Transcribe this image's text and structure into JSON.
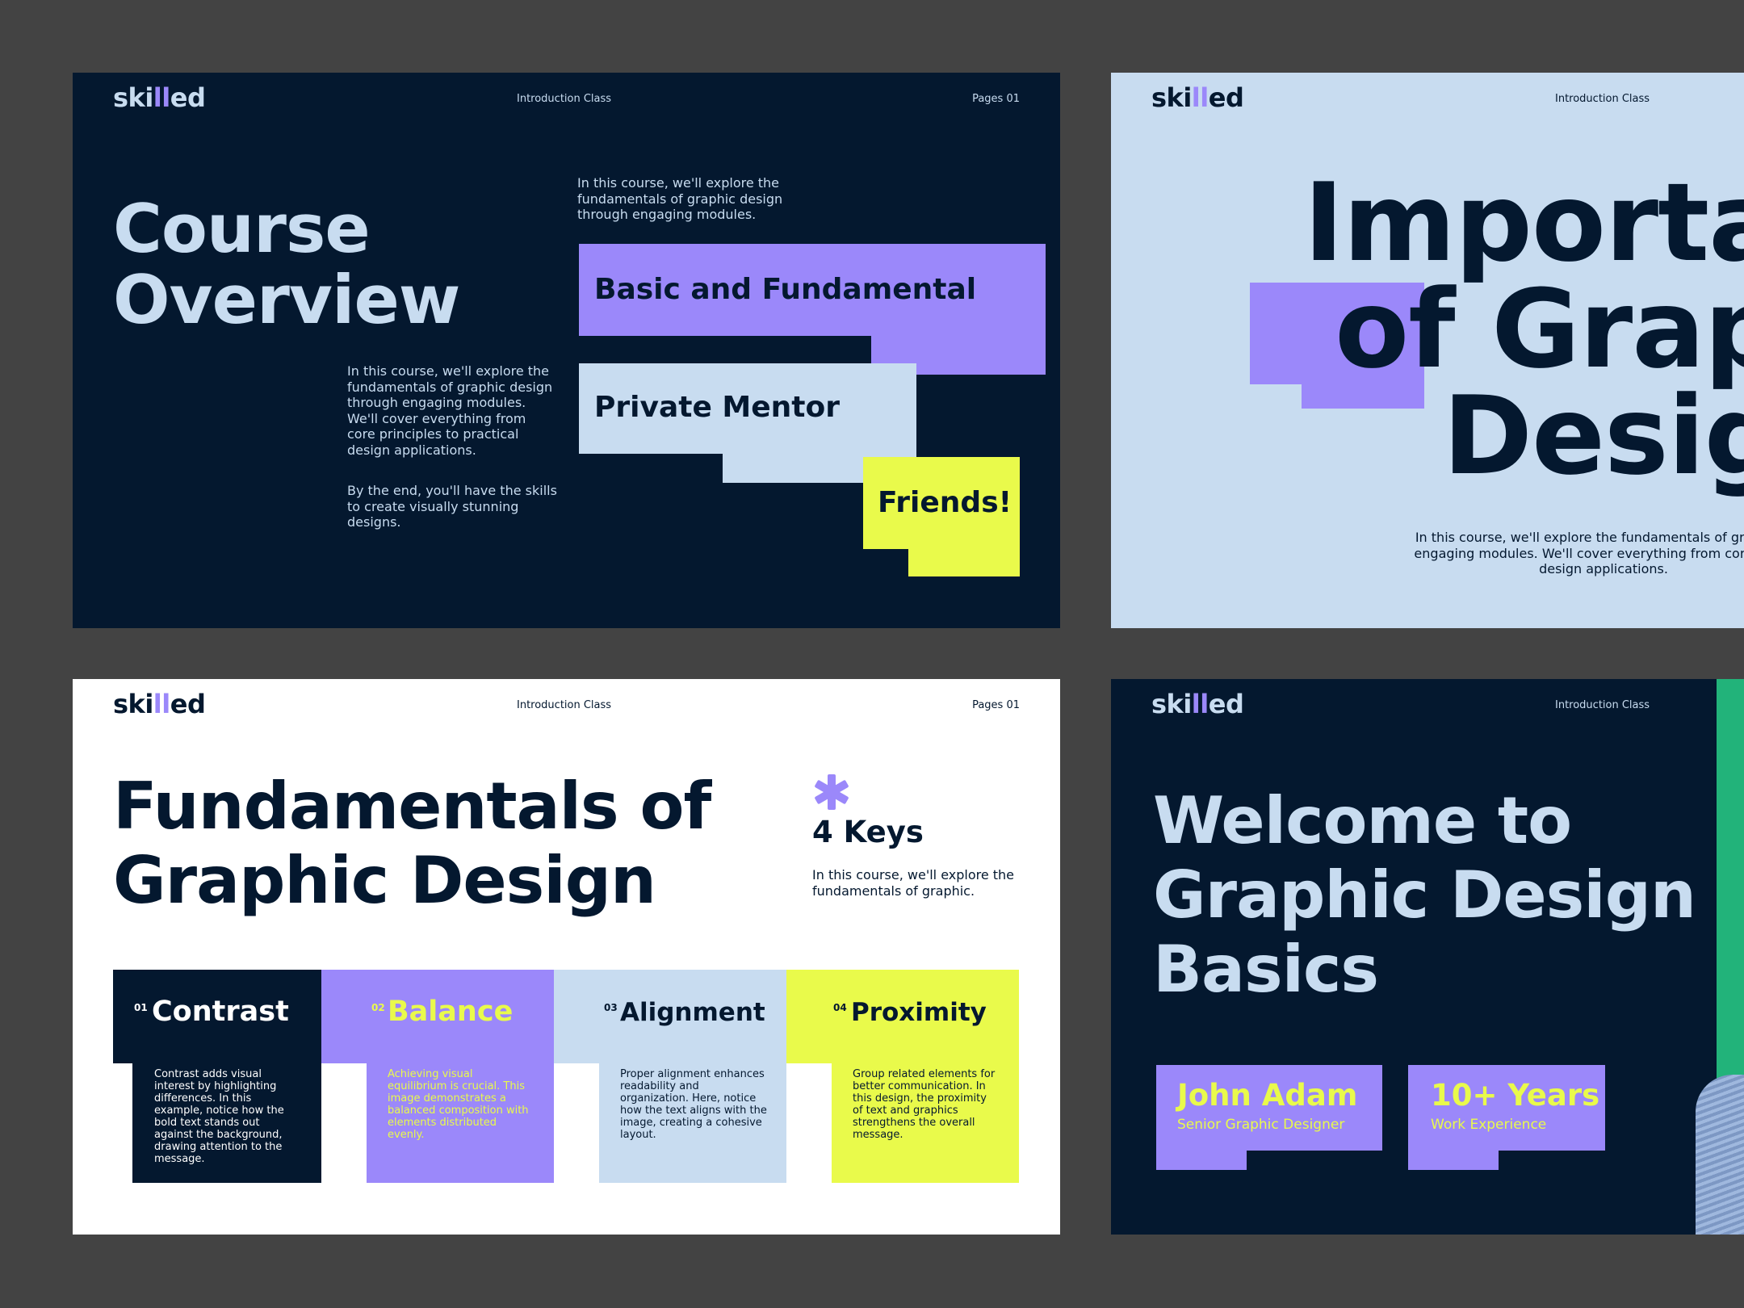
{
  "brand": {
    "logo_pre": "ski",
    "logo_mid": "ll",
    "logo_post": "ed"
  },
  "header": {
    "class_label": "Introduction Class",
    "pages_label": "Pages 01"
  },
  "colors": {
    "navy": "#04182f",
    "lavender": "#9b88fa",
    "light_blue": "#c8dcf0",
    "lime": "#e9fa4b",
    "green": "#22b37a",
    "gray_bg": "#434343"
  },
  "slide1": {
    "title_line1": "Course",
    "title_line2": "Overview",
    "intro": [
      "In this course, we'll explore the",
      "fundamentals of graphic design",
      "through engaging modules."
    ],
    "body1": [
      "In this course, we'll explore the",
      "fundamentals of graphic design",
      "through engaging modules.",
      "We'll cover everything from",
      "core principles to practical",
      "design applications."
    ],
    "body2": [
      "By the end, you'll have the skills",
      "to create visually stunning",
      "designs."
    ],
    "tags": [
      "Basic and Fundamental",
      "Private Mentor",
      "Friends!"
    ]
  },
  "slide2": {
    "title_lines": [
      "Importan",
      "of Graph",
      "Design"
    ],
    "body": [
      "In this course, we'll explore the fundamentals of graphic d",
      "engaging modules. We'll cover everything from core princi",
      "design applications."
    ]
  },
  "slide3": {
    "title_line1": "Fundamentals of",
    "title_line2": "Graphic Design",
    "keys_title": "4 Keys",
    "keys_desc": [
      "In this course, we'll explore the",
      "fundamentals of graphic."
    ],
    "cards": [
      {
        "num": "01",
        "name": "Contrast",
        "desc": [
          "Contrast adds visual",
          "interest by highlighting",
          "differences. In this",
          "example, notice how the",
          "bold text stands out",
          "against the background,",
          "drawing attention to the",
          "message."
        ]
      },
      {
        "num": "02",
        "name": "Balance",
        "desc": [
          "Achieving visual",
          "equilibrium is crucial. This",
          "image demonstrates a",
          "balanced composition with",
          "elements distributed",
          "evenly."
        ]
      },
      {
        "num": "03",
        "name": "Alignment",
        "desc": [
          "Proper alignment enhances",
          "readability and",
          "organization. Here, notice",
          "how the text aligns with the",
          "image, creating a cohesive",
          "layout."
        ]
      },
      {
        "num": "04",
        "name": "Proximity",
        "desc": [
          "Group related elements for",
          "better communication. In",
          "this design, the proximity",
          "of text and graphics",
          "strengthens the overall",
          "message."
        ]
      }
    ]
  },
  "slide4": {
    "title_lines": [
      "Welcome to",
      "Graphic Design",
      "Basics"
    ],
    "person_name": "John Adam",
    "person_role": "Senior Graphic Designer",
    "exp_value": "10+ Years",
    "exp_label": "Work Experience"
  }
}
